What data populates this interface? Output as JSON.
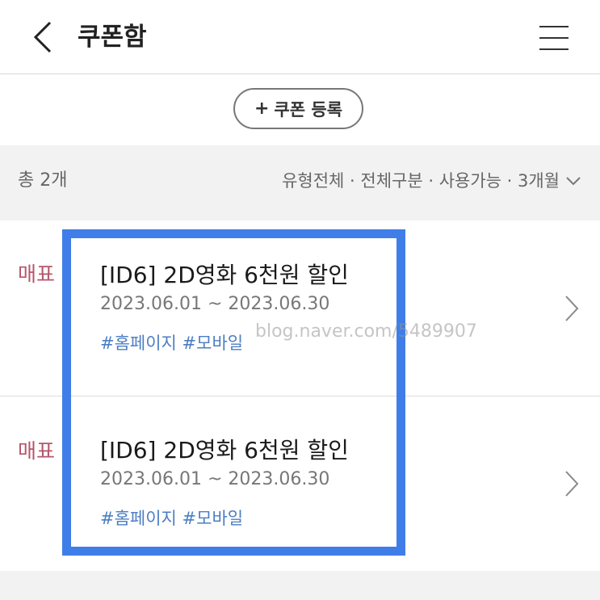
{
  "header": {
    "title": "쿠폰함"
  },
  "register_button": {
    "plus": "+",
    "label": "쿠폰 등록"
  },
  "filter_bar": {
    "total": "총 2개",
    "filters": "유형전체 · 전체구분 · 사용가능 · 3개월"
  },
  "coupons": [
    {
      "badge": "매표",
      "title": "[ID6] 2D영화 6천원 할인",
      "period": "2023.06.01 ~ 2023.06.30",
      "tags": "#홈페이지 #모바일"
    },
    {
      "badge": "매표",
      "title": "[ID6] 2D영화 6천원 할인",
      "period": "2023.06.01 ~ 2023.06.30",
      "tags": "#홈페이지 #모바일"
    }
  ],
  "watermark": "blog.naver.com/5489907",
  "colors": {
    "badge": "#b6566b",
    "tags": "#4d7ec2",
    "highlight": "#3f7ee8"
  }
}
